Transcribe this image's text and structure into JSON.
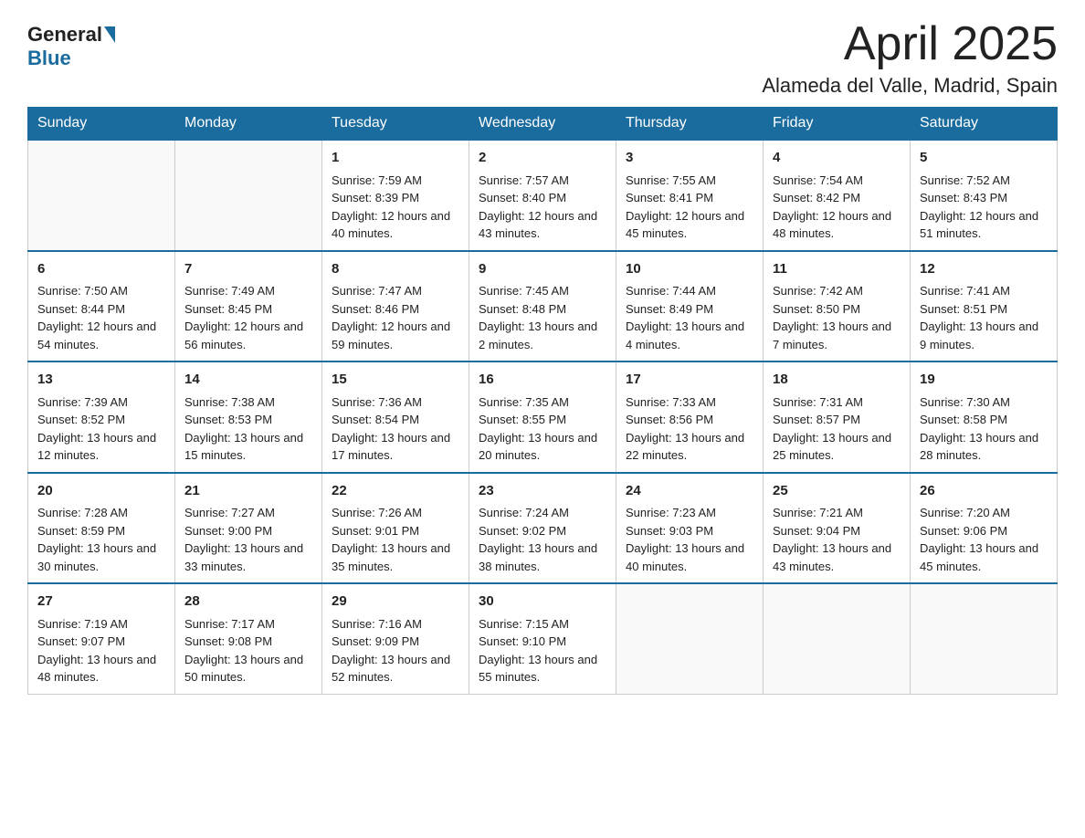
{
  "logo": {
    "general": "General",
    "blue": "Blue"
  },
  "title": "April 2025",
  "subtitle": "Alameda del Valle, Madrid, Spain",
  "headers": [
    "Sunday",
    "Monday",
    "Tuesday",
    "Wednesday",
    "Thursday",
    "Friday",
    "Saturday"
  ],
  "weeks": [
    [
      {
        "day": "",
        "info": ""
      },
      {
        "day": "",
        "info": ""
      },
      {
        "day": "1",
        "info": "Sunrise: 7:59 AM\nSunset: 8:39 PM\nDaylight: 12 hours and 40 minutes."
      },
      {
        "day": "2",
        "info": "Sunrise: 7:57 AM\nSunset: 8:40 PM\nDaylight: 12 hours and 43 minutes."
      },
      {
        "day": "3",
        "info": "Sunrise: 7:55 AM\nSunset: 8:41 PM\nDaylight: 12 hours and 45 minutes."
      },
      {
        "day": "4",
        "info": "Sunrise: 7:54 AM\nSunset: 8:42 PM\nDaylight: 12 hours and 48 minutes."
      },
      {
        "day": "5",
        "info": "Sunrise: 7:52 AM\nSunset: 8:43 PM\nDaylight: 12 hours and 51 minutes."
      }
    ],
    [
      {
        "day": "6",
        "info": "Sunrise: 7:50 AM\nSunset: 8:44 PM\nDaylight: 12 hours and 54 minutes."
      },
      {
        "day": "7",
        "info": "Sunrise: 7:49 AM\nSunset: 8:45 PM\nDaylight: 12 hours and 56 minutes."
      },
      {
        "day": "8",
        "info": "Sunrise: 7:47 AM\nSunset: 8:46 PM\nDaylight: 12 hours and 59 minutes."
      },
      {
        "day": "9",
        "info": "Sunrise: 7:45 AM\nSunset: 8:48 PM\nDaylight: 13 hours and 2 minutes."
      },
      {
        "day": "10",
        "info": "Sunrise: 7:44 AM\nSunset: 8:49 PM\nDaylight: 13 hours and 4 minutes."
      },
      {
        "day": "11",
        "info": "Sunrise: 7:42 AM\nSunset: 8:50 PM\nDaylight: 13 hours and 7 minutes."
      },
      {
        "day": "12",
        "info": "Sunrise: 7:41 AM\nSunset: 8:51 PM\nDaylight: 13 hours and 9 minutes."
      }
    ],
    [
      {
        "day": "13",
        "info": "Sunrise: 7:39 AM\nSunset: 8:52 PM\nDaylight: 13 hours and 12 minutes."
      },
      {
        "day": "14",
        "info": "Sunrise: 7:38 AM\nSunset: 8:53 PM\nDaylight: 13 hours and 15 minutes."
      },
      {
        "day": "15",
        "info": "Sunrise: 7:36 AM\nSunset: 8:54 PM\nDaylight: 13 hours and 17 minutes."
      },
      {
        "day": "16",
        "info": "Sunrise: 7:35 AM\nSunset: 8:55 PM\nDaylight: 13 hours and 20 minutes."
      },
      {
        "day": "17",
        "info": "Sunrise: 7:33 AM\nSunset: 8:56 PM\nDaylight: 13 hours and 22 minutes."
      },
      {
        "day": "18",
        "info": "Sunrise: 7:31 AM\nSunset: 8:57 PM\nDaylight: 13 hours and 25 minutes."
      },
      {
        "day": "19",
        "info": "Sunrise: 7:30 AM\nSunset: 8:58 PM\nDaylight: 13 hours and 28 minutes."
      }
    ],
    [
      {
        "day": "20",
        "info": "Sunrise: 7:28 AM\nSunset: 8:59 PM\nDaylight: 13 hours and 30 minutes."
      },
      {
        "day": "21",
        "info": "Sunrise: 7:27 AM\nSunset: 9:00 PM\nDaylight: 13 hours and 33 minutes."
      },
      {
        "day": "22",
        "info": "Sunrise: 7:26 AM\nSunset: 9:01 PM\nDaylight: 13 hours and 35 minutes."
      },
      {
        "day": "23",
        "info": "Sunrise: 7:24 AM\nSunset: 9:02 PM\nDaylight: 13 hours and 38 minutes."
      },
      {
        "day": "24",
        "info": "Sunrise: 7:23 AM\nSunset: 9:03 PM\nDaylight: 13 hours and 40 minutes."
      },
      {
        "day": "25",
        "info": "Sunrise: 7:21 AM\nSunset: 9:04 PM\nDaylight: 13 hours and 43 minutes."
      },
      {
        "day": "26",
        "info": "Sunrise: 7:20 AM\nSunset: 9:06 PM\nDaylight: 13 hours and 45 minutes."
      }
    ],
    [
      {
        "day": "27",
        "info": "Sunrise: 7:19 AM\nSunset: 9:07 PM\nDaylight: 13 hours and 48 minutes."
      },
      {
        "day": "28",
        "info": "Sunrise: 7:17 AM\nSunset: 9:08 PM\nDaylight: 13 hours and 50 minutes."
      },
      {
        "day": "29",
        "info": "Sunrise: 7:16 AM\nSunset: 9:09 PM\nDaylight: 13 hours and 52 minutes."
      },
      {
        "day": "30",
        "info": "Sunrise: 7:15 AM\nSunset: 9:10 PM\nDaylight: 13 hours and 55 minutes."
      },
      {
        "day": "",
        "info": ""
      },
      {
        "day": "",
        "info": ""
      },
      {
        "day": "",
        "info": ""
      }
    ]
  ]
}
